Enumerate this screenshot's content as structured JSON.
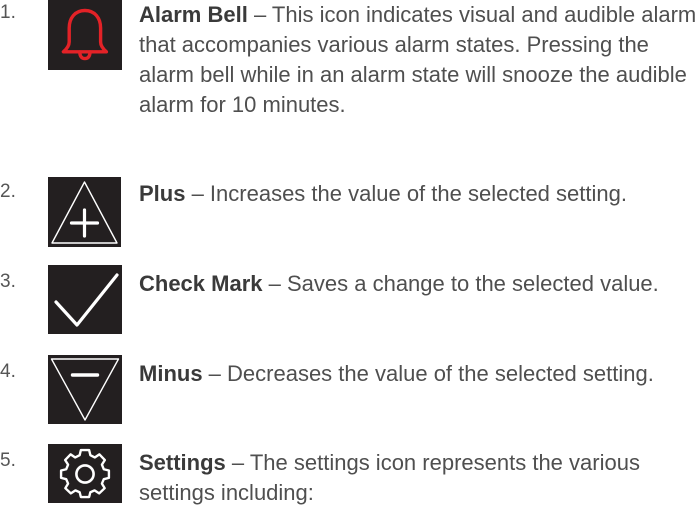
{
  "items": [
    {
      "number": "1.",
      "term": "Alarm Bell",
      "description": " – This icon indicates visual and audible alarm that accompanies various alarm states. Pressing the alarm bell while in an alarm state will snooze the audible alarm for 10 minutes.",
      "icon": "bell-icon",
      "icon_color": "#e32227"
    },
    {
      "number": "2.",
      "term": "Plus",
      "description": " – Increases the value of the selected setting.",
      "icon": "plus-triangle-icon",
      "icon_color": "#ffffff"
    },
    {
      "number": "3.",
      "term": "Check Mark",
      "description": " – Saves a change to the selected value.",
      "icon": "check-mark-icon",
      "icon_color": "#ffffff"
    },
    {
      "number": "4.",
      "term": "Minus",
      "description": " – Decreases the value of the selected setting.",
      "icon": "minus-triangle-icon",
      "icon_color": "#ffffff"
    },
    {
      "number": "5.",
      "term": "Settings",
      "description": " – The settings icon represents the various settings including:",
      "icon": "gear-icon",
      "icon_color": "#ffffff"
    }
  ],
  "colors": {
    "icon_background": "#231f20",
    "text": "#4f4f4f"
  }
}
